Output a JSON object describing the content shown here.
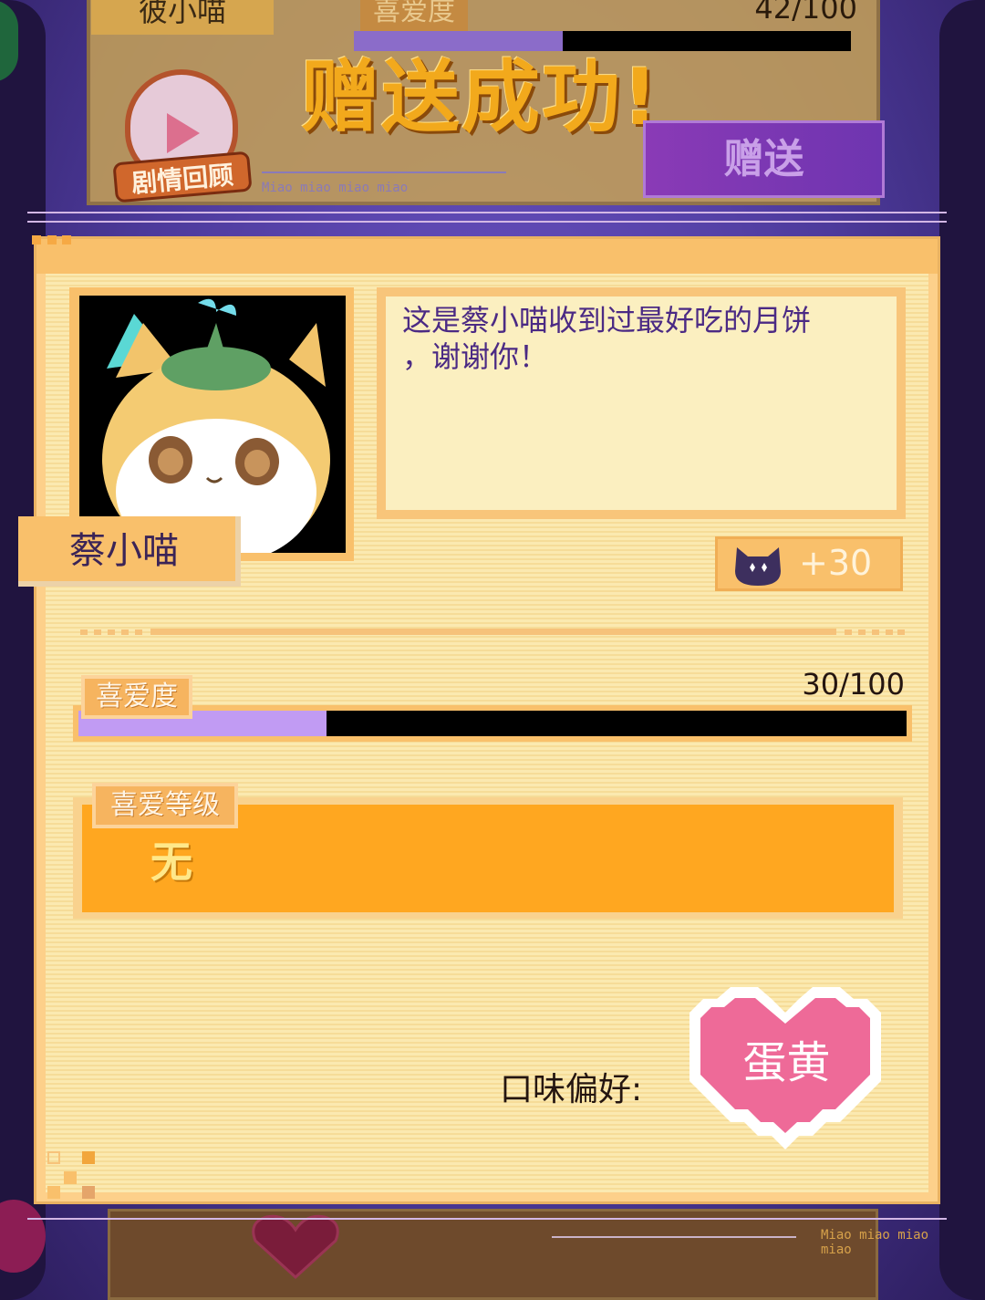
{
  "background": {
    "name": "彼小喵",
    "affinity_label": "喜爱度",
    "affinity_score": "42/100",
    "affinity_fraction": 0.42,
    "success_title": "赠送成功!",
    "gift_button": "赠送",
    "review_label": "剧情回顾",
    "caption": "Miao miao miao miao",
    "bottom_caption": "Miao miao miao miao",
    "bottom_heart_mark": "?"
  },
  "card": {
    "character_name": "蔡小喵",
    "dialogue": "这是蔡小喵收到过最好吃的月饼，谢谢你！",
    "dialogue_line1": "这是蔡小喵收到过最好吃的月饼",
    "dialogue_line2": "，谢谢你！",
    "reward_text": "+30",
    "affinity_label": "喜爱度",
    "affinity_score": "30/100",
    "affinity_fraction": 0.3,
    "level_label": "喜爱等级",
    "level_value": "无",
    "taste_label": "口味偏好:",
    "taste_value": "蛋黄"
  },
  "colors": {
    "card_bg": "#fbe9b0",
    "frame_orange": "#f9c06b",
    "level_orange": "#ffa720",
    "affinity_fill": "#c19bf3",
    "heart_pink": "#ee6a98",
    "dialogue_text": "#4b2a84"
  },
  "icons": {
    "reward_icon": "cat-face-icon",
    "review_icon": "paw-play-icon"
  }
}
